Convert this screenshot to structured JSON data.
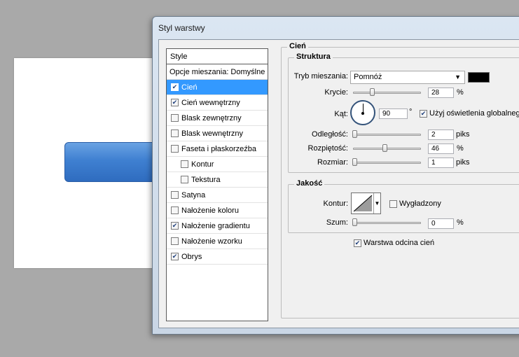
{
  "dialog": {
    "title": "Styl warstwy"
  },
  "styles_list": {
    "header": "Style",
    "blending": "Opcje mieszania: Domyślne",
    "items": [
      {
        "label": "Cień",
        "checked": true,
        "selected": true,
        "sub": false
      },
      {
        "label": "Cień wewnętrzny",
        "checked": true,
        "selected": false,
        "sub": false
      },
      {
        "label": "Blask zewnętrzny",
        "checked": false,
        "selected": false,
        "sub": false
      },
      {
        "label": "Blask wewnętrzny",
        "checked": false,
        "selected": false,
        "sub": false
      },
      {
        "label": "Faseta i płaskorzeźba",
        "checked": false,
        "selected": false,
        "sub": false
      },
      {
        "label": "Kontur",
        "checked": false,
        "selected": false,
        "sub": true
      },
      {
        "label": "Tekstura",
        "checked": false,
        "selected": false,
        "sub": true
      },
      {
        "label": "Satyna",
        "checked": false,
        "selected": false,
        "sub": false
      },
      {
        "label": "Nałożenie koloru",
        "checked": false,
        "selected": false,
        "sub": false
      },
      {
        "label": "Nałożenie gradientu",
        "checked": true,
        "selected": false,
        "sub": false
      },
      {
        "label": "Nałożenie wzorku",
        "checked": false,
        "selected": false,
        "sub": false
      },
      {
        "label": "Obrys",
        "checked": true,
        "selected": false,
        "sub": false
      }
    ]
  },
  "panel": {
    "title": "Cień",
    "structure": {
      "title": "Struktura",
      "blend_label": "Tryb mieszania:",
      "blend_value": "Pomnóż",
      "shadow_color": "#000000",
      "opacity_label": "Krycie:",
      "opacity_value": "28",
      "opacity_unit": "%",
      "angle_label": "Kąt:",
      "angle_value": "90",
      "angle_unit": "°",
      "global_light_label": "Użyj oświetlenia globalnego",
      "distance_label": "Odległość:",
      "distance_value": "2",
      "distance_unit": "piks",
      "spread_label": "Rozpiętość:",
      "spread_value": "46",
      "spread_unit": "%",
      "size_label": "Rozmiar:",
      "size_value": "1",
      "size_unit": "piks"
    },
    "quality": {
      "title": "Jakość",
      "contour_label": "Kontur:",
      "antialias_label": "Wygładzony",
      "noise_label": "Szum:",
      "noise_value": "0",
      "noise_unit": "%"
    },
    "knockout_label": "Warstwa odcina cień"
  },
  "colors": {
    "selection": "#3399ff",
    "button_blue": "#3f80d1"
  }
}
